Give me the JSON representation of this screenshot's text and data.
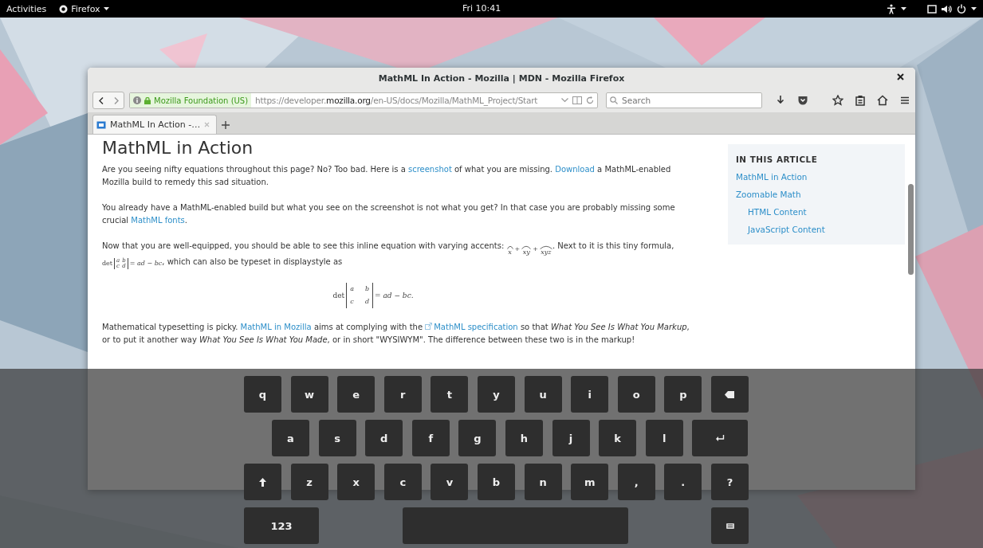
{
  "top_bar": {
    "activities": "Activities",
    "app_menu": "Firefox",
    "clock": "Fri 10:41"
  },
  "window": {
    "title": "MathML In Action - Mozilla | MDN - Mozilla Firefox",
    "url_bar": {
      "identity": "Mozilla Foundation (US)",
      "url_prefix": "https://developer.",
      "url_domain": "mozilla.org",
      "url_path": "/en-US/docs/Mozilla/MathML_Project/Start"
    },
    "search": {
      "placeholder": "Search"
    },
    "tabs": [
      {
        "label": "MathML In Action -…",
        "selected": true
      }
    ]
  },
  "article": {
    "heading": "MathML in Action",
    "paragraphs": [
      [
        {
          "kind": "text",
          "text": "Are you seeing nifty equations throughout this page? No? Too bad. Here is a "
        },
        {
          "kind": "link",
          "text": "screenshot"
        },
        {
          "kind": "text",
          "text": " of what you are missing. "
        },
        {
          "kind": "link",
          "text": "Download"
        },
        {
          "kind": "text",
          "text": " a MathML-enabled Mozilla build to remedy this sad situation."
        }
      ],
      [
        {
          "kind": "text",
          "text": "You already have a MathML-enabled build but what you see on the screenshot is not what you get? In that case you are probably missing some crucial "
        },
        {
          "kind": "link",
          "text": "MathML fonts"
        },
        {
          "kind": "text",
          "text": "."
        }
      ],
      [
        {
          "kind": "text",
          "text": "Now that you are well-equipped, you should be able to see this inline equation with varying accents: "
        },
        {
          "kind": "accents",
          "terms": [
            "x",
            "xy",
            "xyz"
          ],
          "operator": "+"
        },
        {
          "kind": "text",
          "text": ". Next to it is this tiny formula, "
        },
        {
          "kind": "determinant",
          "operator": "det",
          "matrix": [
            [
              "a",
              "b"
            ],
            [
              "c",
              "d"
            ]
          ],
          "result": "= ad − bc"
        },
        {
          "kind": "text",
          "text": ", which can also be typeset in displaystyle as"
        }
      ],
      [
        {
          "kind": "display",
          "operator": "det",
          "matrix": [
            [
              "a",
              "b"
            ],
            [
              "c",
              "d"
            ]
          ],
          "result": "= ad − bc."
        }
      ],
      [
        {
          "kind": "text",
          "text": "Mathematical typesetting is picky. "
        },
        {
          "kind": "link",
          "text": "MathML in Mozilla"
        },
        {
          "kind": "text",
          "text": " aims at complying with the "
        },
        {
          "kind": "external-link",
          "text": "MathML specification"
        },
        {
          "kind": "text",
          "text": " so that "
        },
        {
          "kind": "italic",
          "text": "What You See Is What You Markup"
        },
        {
          "kind": "text",
          "text": ", or to put it another way "
        },
        {
          "kind": "italic",
          "text": "What You See Is What You Made"
        },
        {
          "kind": "text",
          "text": ", or in short \"WYSIWYM\". The difference between these two is in the markup!"
        }
      ]
    ]
  },
  "toc": {
    "title": "IN THIS ARTICLE",
    "items": [
      {
        "label": "MathML in Action"
      },
      {
        "label": "Zoomable Math",
        "children": [
          {
            "label": "HTML Content"
          },
          {
            "label": "JavaScript Content"
          }
        ]
      }
    ]
  },
  "keyboard": {
    "rows": [
      [
        {
          "kind": "letter",
          "label": "q"
        },
        {
          "kind": "letter",
          "label": "w"
        },
        {
          "kind": "letter",
          "label": "e"
        },
        {
          "kind": "letter",
          "label": "r"
        },
        {
          "kind": "letter",
          "label": "t"
        },
        {
          "kind": "letter",
          "label": "y"
        },
        {
          "kind": "letter",
          "label": "u"
        },
        {
          "kind": "letter",
          "label": "i"
        },
        {
          "kind": "letter",
          "label": "o"
        },
        {
          "kind": "letter",
          "label": "p"
        },
        {
          "kind": "backspace"
        }
      ],
      [
        {
          "kind": "letter",
          "label": "a"
        },
        {
          "kind": "letter",
          "label": "s"
        },
        {
          "kind": "letter",
          "label": "d"
        },
        {
          "kind": "letter",
          "label": "f"
        },
        {
          "kind": "letter",
          "label": "g"
        },
        {
          "kind": "letter",
          "label": "h"
        },
        {
          "kind": "letter",
          "label": "j"
        },
        {
          "kind": "letter",
          "label": "k"
        },
        {
          "kind": "letter",
          "label": "l"
        },
        {
          "kind": "enter"
        }
      ],
      [
        {
          "kind": "shift"
        },
        {
          "kind": "letter",
          "label": "z"
        },
        {
          "kind": "letter",
          "label": "x"
        },
        {
          "kind": "letter",
          "label": "c"
        },
        {
          "kind": "letter",
          "label": "v"
        },
        {
          "kind": "letter",
          "label": "b"
        },
        {
          "kind": "letter",
          "label": "n"
        },
        {
          "kind": "letter",
          "label": "m"
        },
        {
          "kind": "letter",
          "label": ","
        },
        {
          "kind": "letter",
          "label": "."
        },
        {
          "kind": "letter",
          "label": "?"
        }
      ],
      [
        {
          "kind": "numbers",
          "label": "123"
        },
        {
          "kind": "space"
        },
        {
          "kind": "hide"
        }
      ]
    ]
  }
}
